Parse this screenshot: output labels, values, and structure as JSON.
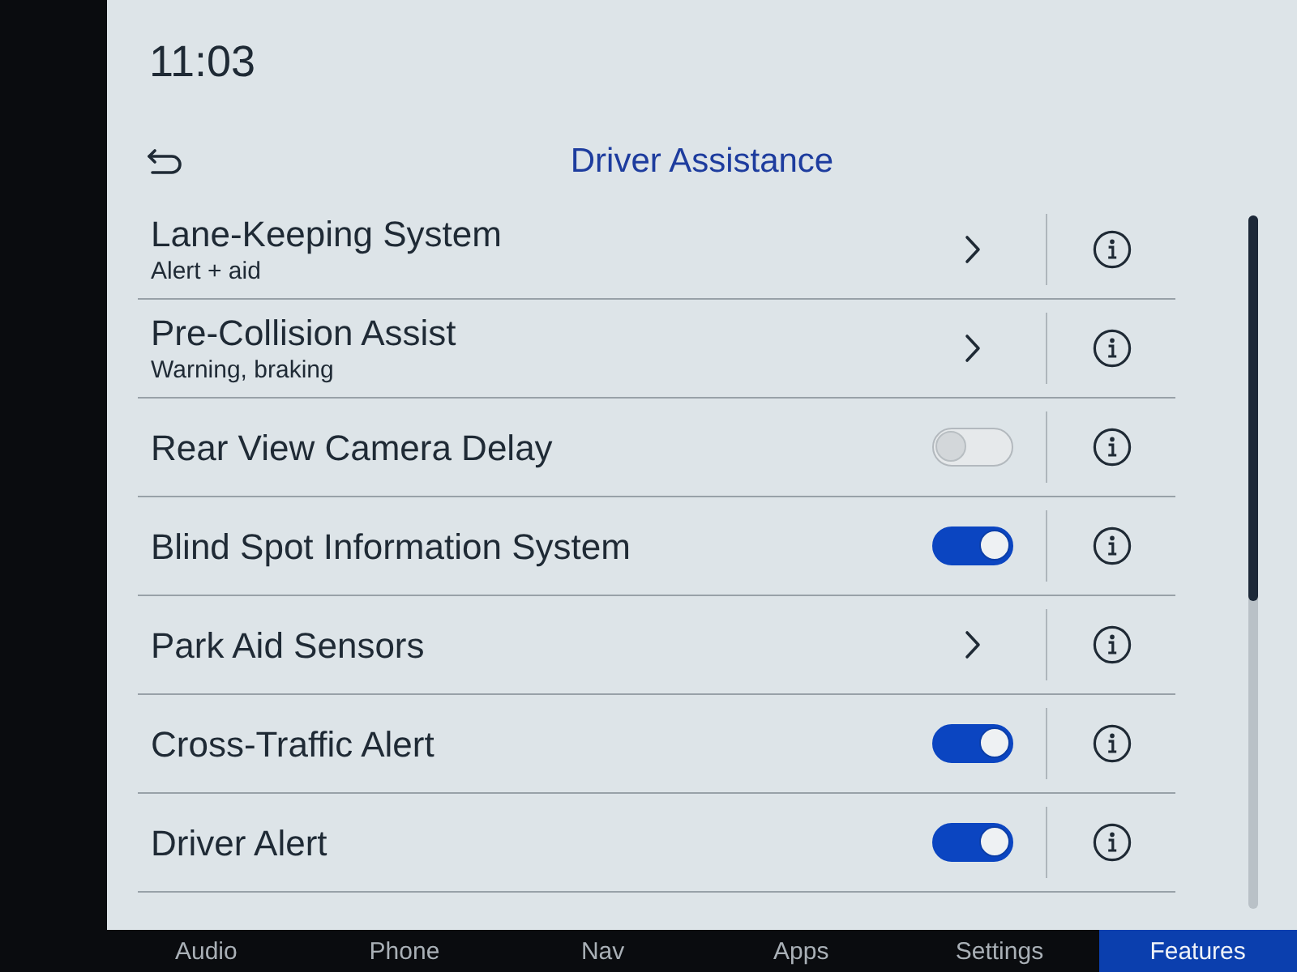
{
  "clock": {
    "time": "11:03"
  },
  "header": {
    "title": "Driver Assistance"
  },
  "settings": [
    {
      "kind": "submenu",
      "label": "Lane-Keeping System",
      "sublabel": "Alert + aid"
    },
    {
      "kind": "submenu",
      "label": "Pre-Collision Assist",
      "sublabel": "Warning, braking"
    },
    {
      "kind": "toggle",
      "label": "Rear View Camera Delay",
      "on": false
    },
    {
      "kind": "toggle",
      "label": "Blind Spot Information System",
      "on": true
    },
    {
      "kind": "submenu",
      "label": "Park Aid Sensors"
    },
    {
      "kind": "toggle",
      "label": "Cross-Traffic Alert",
      "on": true
    },
    {
      "kind": "toggle",
      "label": "Driver Alert",
      "on": true
    }
  ],
  "nav_tabs": [
    {
      "label": "Audio",
      "selected": false
    },
    {
      "label": "Phone",
      "selected": false
    },
    {
      "label": "Nav",
      "selected": false
    },
    {
      "label": "Apps",
      "selected": false
    },
    {
      "label": "Settings",
      "selected": false
    },
    {
      "label": "Features",
      "selected": true
    }
  ]
}
